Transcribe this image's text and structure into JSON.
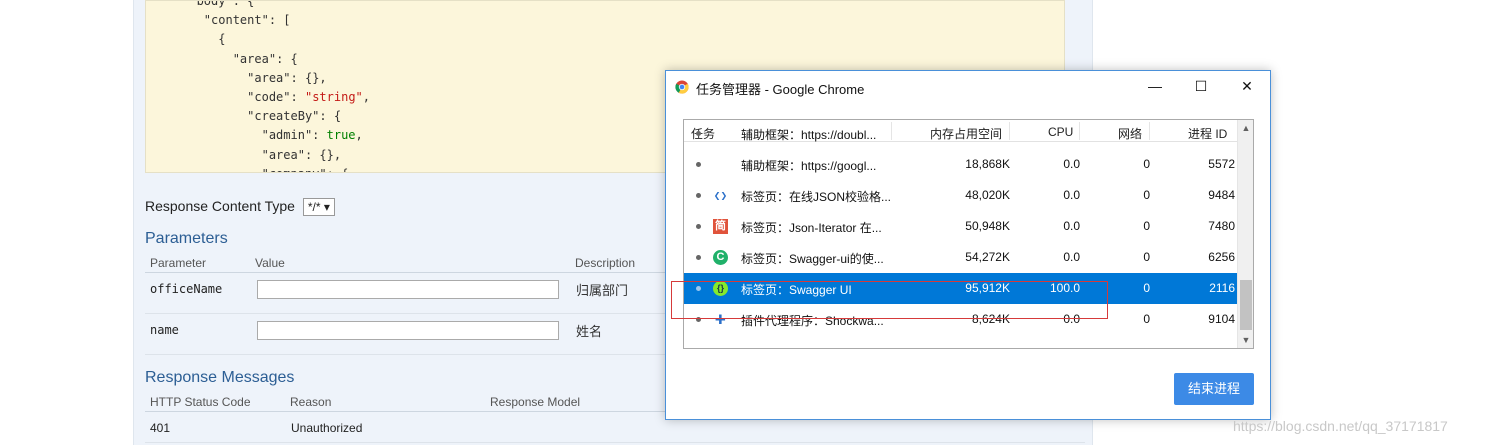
{
  "swagger": {
    "code_lines": [
      {
        "indent": 3,
        "key": "\"body\"",
        "rest": ": {"
      },
      {
        "indent": 4,
        "key": "\"content\"",
        "rest": ": ["
      },
      {
        "indent": 5,
        "key": "",
        "rest": "{"
      },
      {
        "indent": 6,
        "key": "\"area\"",
        "rest": ": {"
      },
      {
        "indent": 7,
        "key": "\"area\"",
        "rest": ": {},"
      },
      {
        "indent": 7,
        "key": "\"code\"",
        "rest": ": ",
        "str": "\"string\"",
        "tail": ","
      },
      {
        "indent": 7,
        "key": "\"createBy\"",
        "rest": ": {"
      },
      {
        "indent": 8,
        "key": "\"admin\"",
        "rest": ": ",
        "bool": "true",
        "tail": ","
      },
      {
        "indent": 8,
        "key": "\"area\"",
        "rest": ": {},"
      },
      {
        "indent": 8,
        "key": "\"company\"",
        "rest": ": {"
      }
    ],
    "response_content_type_label": "Response Content Type",
    "response_content_type_value": "*/*",
    "parameters_title": "Parameters",
    "param_headers": {
      "parameter": "Parameter",
      "value": "Value",
      "description": "Description"
    },
    "params": [
      {
        "name": "officeName",
        "description": "归属部门"
      },
      {
        "name": "name",
        "description": "姓名"
      }
    ],
    "response_messages_title": "Response Messages",
    "resp_headers": {
      "status": "HTTP Status Code",
      "reason": "Reason",
      "model": "Response Model"
    },
    "responses": [
      {
        "code": "401",
        "reason": "Unauthorized"
      }
    ]
  },
  "task_manager": {
    "title": "任务管理器 - Google Chrome",
    "buttons": {
      "minimize": "—",
      "maximize": "☐",
      "close": "✕"
    },
    "columns": {
      "task": "任务",
      "memory": "内存占用空间",
      "cpu": "CPU",
      "network": "网络",
      "pid": "进程 ID"
    },
    "rows": [
      {
        "icon": "none",
        "task": "辅助框架：https://doubl...",
        "memory": "",
        "cpu": "",
        "network": "",
        "pid": "",
        "selected": false
      },
      {
        "icon": "none",
        "task": "辅助框架：https://googl...",
        "memory": "18,868K",
        "cpu": "0.0",
        "network": "0",
        "pid": "5572",
        "selected": false
      },
      {
        "icon": "code-icon",
        "task": "标签页：在线JSON校验格...",
        "memory": "48,020K",
        "cpu": "0.0",
        "network": "0",
        "pid": "9484",
        "selected": false
      },
      {
        "icon": "jian-icon",
        "task": "标签页：Json-Iterator 在...",
        "memory": "50,948K",
        "cpu": "0.0",
        "network": "0",
        "pid": "7480",
        "selected": false
      },
      {
        "icon": "c-icon",
        "task": "标签页：Swagger-ui的使...",
        "memory": "54,272K",
        "cpu": "0.0",
        "network": "0",
        "pid": "6256",
        "selected": false
      },
      {
        "icon": "swagger-icon",
        "task": "标签页：Swagger UI",
        "memory": "95,912K",
        "cpu": "100.0",
        "network": "0",
        "pid": "2116",
        "selected": true
      },
      {
        "icon": "puzzle-icon",
        "task": "插件代理程序：Shockwa...",
        "memory": "8,624K",
        "cpu": "0.0",
        "network": "0",
        "pid": "9104",
        "selected": false
      }
    ],
    "end_process_label": "结束进程"
  },
  "watermark": "https://blog.csdn.net/qq_37171817",
  "colors": {
    "accent": "#0078d7",
    "button": "#3c8ae6",
    "highlight": "#d63a3a",
    "param_heading": "#2c5e94"
  }
}
